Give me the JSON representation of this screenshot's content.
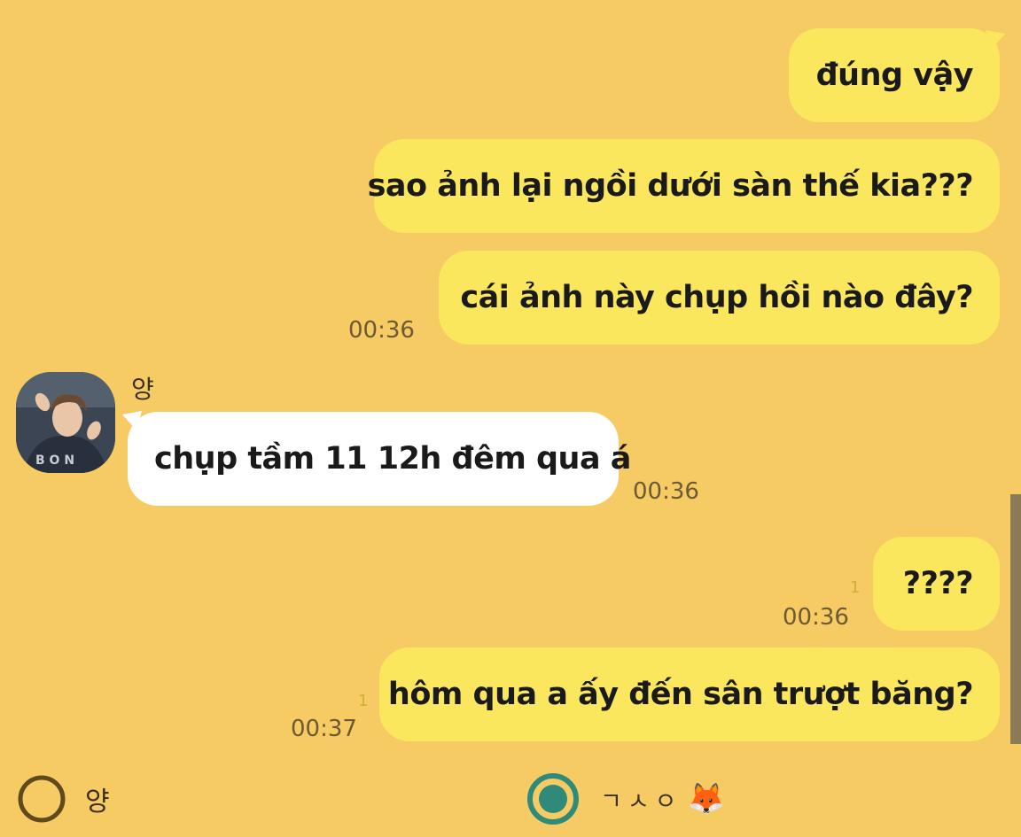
{
  "messages": [
    {
      "direction": "out",
      "text": "đúng vậy"
    },
    {
      "direction": "out",
      "text": "sao ảnh lại ngồi dưới sàn thế kia???"
    },
    {
      "direction": "out",
      "text": "cái ảnh này chụp hồi nào đây?",
      "time": "00:36"
    },
    {
      "direction": "in",
      "sender": "양",
      "text": "chụp tầm 11 12h đêm qua á",
      "time": "00:36"
    },
    {
      "direction": "out",
      "text": "????",
      "time": "00:36",
      "unread": "1"
    },
    {
      "direction": "out",
      "text": "hôm qua a ấy đến sân trượt băng?",
      "time": "00:37",
      "unread": "1"
    }
  ],
  "footer": {
    "left_label": "양",
    "right_label": "ㄱㅅㅇ",
    "right_emoji": "🦊"
  },
  "colors": {
    "background": "#F7CB64",
    "outgoing_bubble": "#FBE75E",
    "incoming_bubble": "#FFFFFF",
    "ring_left": "#5f4a1c",
    "ring_right": "#2f8a7a"
  },
  "icons": {
    "left_selector": "empty-circle",
    "right_selector": "filled-radio-circle",
    "avatar": "profile-photo"
  }
}
